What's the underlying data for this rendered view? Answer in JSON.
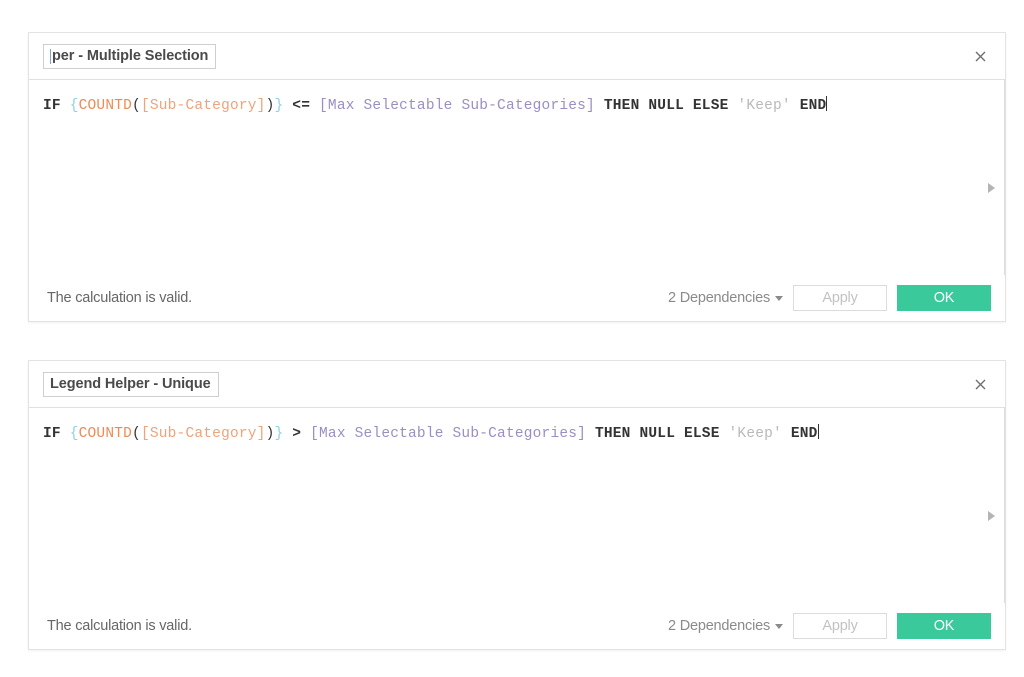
{
  "page": {
    "background": "#ffffff"
  },
  "theme": {
    "accent_ok": "#3ac99a",
    "border": "#e3e3e3",
    "text": "#4a4a4a",
    "muted": "#8a8a8a",
    "token_function": "#f08a52",
    "token_field": "#f0a27a",
    "token_parameter": "#9b8ec4",
    "token_brace": "#8fd0e8",
    "token_string": "#b9b9b9",
    "token_keyword": "#333333"
  },
  "dialogs": [
    {
      "name_field": {
        "value": "per - Multiple Selection",
        "full_value": "Legend Helper - Multiple Selection",
        "placeholder": "Enter a name"
      },
      "close_icon": "close-icon",
      "expander_icon": "triangle-right-icon",
      "formula": {
        "tokens": [
          {
            "text": "IF",
            "type": "keyword"
          },
          {
            "text": " ",
            "type": "plain"
          },
          {
            "text": "{",
            "type": "brace"
          },
          {
            "text": "COUNTD",
            "type": "function"
          },
          {
            "text": "(",
            "type": "plain"
          },
          {
            "text": "[Sub-Category]",
            "type": "field"
          },
          {
            "text": ")",
            "type": "plain"
          },
          {
            "text": "}",
            "type": "brace"
          },
          {
            "text": " ",
            "type": "plain"
          },
          {
            "text": "<=",
            "type": "operator"
          },
          {
            "text": " ",
            "type": "plain"
          },
          {
            "text": "[Max Selectable Sub-Categories]",
            "type": "parameter"
          },
          {
            "text": " ",
            "type": "plain"
          },
          {
            "text": "THEN",
            "type": "keyword"
          },
          {
            "text": " ",
            "type": "plain"
          },
          {
            "text": "NULL",
            "type": "keyword"
          },
          {
            "text": " ",
            "type": "plain"
          },
          {
            "text": "ELSE",
            "type": "keyword"
          },
          {
            "text": " ",
            "type": "plain"
          },
          {
            "text": "'Keep'",
            "type": "string"
          },
          {
            "text": " ",
            "type": "plain"
          },
          {
            "text": "END",
            "type": "keyword"
          }
        ],
        "plain_text": "IF {COUNTD([Sub-Category])} <= [Max Selectable Sub-Categories] THEN NULL ELSE 'Keep' END"
      },
      "footer": {
        "status": "The calculation is valid.",
        "dependencies_label": "2 Dependencies",
        "apply_label": "Apply",
        "ok_label": "OK",
        "apply_enabled": false
      }
    },
    {
      "name_field": {
        "value": "Legend Helper - Unique",
        "full_value": "Legend Helper - Unique",
        "placeholder": "Enter a name"
      },
      "close_icon": "close-icon",
      "expander_icon": "triangle-right-icon",
      "formula": {
        "tokens": [
          {
            "text": "IF",
            "type": "keyword"
          },
          {
            "text": " ",
            "type": "plain"
          },
          {
            "text": "{",
            "type": "brace"
          },
          {
            "text": "COUNTD",
            "type": "function"
          },
          {
            "text": "(",
            "type": "plain"
          },
          {
            "text": "[Sub-Category]",
            "type": "field"
          },
          {
            "text": ")",
            "type": "plain"
          },
          {
            "text": "}",
            "type": "brace"
          },
          {
            "text": " ",
            "type": "plain"
          },
          {
            "text": ">",
            "type": "operator"
          },
          {
            "text": " ",
            "type": "plain"
          },
          {
            "text": "[Max Selectable Sub-Categories]",
            "type": "parameter"
          },
          {
            "text": " ",
            "type": "plain"
          },
          {
            "text": "THEN",
            "type": "keyword"
          },
          {
            "text": " ",
            "type": "plain"
          },
          {
            "text": "NULL",
            "type": "keyword"
          },
          {
            "text": " ",
            "type": "plain"
          },
          {
            "text": "ELSE",
            "type": "keyword"
          },
          {
            "text": " ",
            "type": "plain"
          },
          {
            "text": "'Keep'",
            "type": "string"
          },
          {
            "text": " ",
            "type": "plain"
          },
          {
            "text": "END",
            "type": "keyword"
          }
        ],
        "plain_text": "IF {COUNTD([Sub-Category])} > [Max Selectable Sub-Categories] THEN NULL ELSE 'Keep' END"
      },
      "footer": {
        "status": "The calculation is valid.",
        "dependencies_label": "2 Dependencies",
        "apply_label": "Apply",
        "ok_label": "OK",
        "apply_enabled": false
      }
    }
  ]
}
